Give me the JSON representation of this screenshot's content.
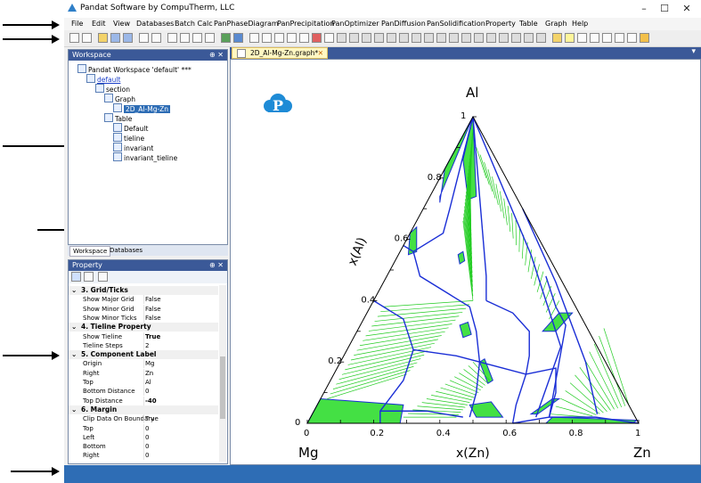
{
  "window": {
    "title": "Pandat Software by CompuTherm, LLC",
    "minimize": "–",
    "maximize": "☐",
    "close": "✕"
  },
  "menu": [
    "File",
    "Edit",
    "View",
    "Databases",
    "Batch Calc",
    "PanPhaseDiagram",
    "PanPrecipitation",
    "PanOptimizer",
    "PanDiffusion",
    "PanSolidification",
    "Property",
    "Table",
    "Graph",
    "Help"
  ],
  "workspace": {
    "header": "Workspace",
    "pin": "⊕ ✕",
    "tree": [
      {
        "label": "Pandat Workspace 'default' ***",
        "indent": 0,
        "link": false
      },
      {
        "label": "default",
        "indent": 1,
        "link": true
      },
      {
        "label": "section",
        "indent": 2,
        "link": false
      },
      {
        "label": "Graph",
        "indent": 3,
        "link": false
      },
      {
        "label": "2D_Al-Mg-Zn",
        "indent": 4,
        "link": false,
        "selected": true
      },
      {
        "label": "Table",
        "indent": 3,
        "link": false
      },
      {
        "label": "Default",
        "indent": 4,
        "link": false
      },
      {
        "label": "tieline",
        "indent": 4,
        "link": false
      },
      {
        "label": "invariant",
        "indent": 4,
        "link": false
      },
      {
        "label": "invariant_tieline",
        "indent": 4,
        "link": false
      }
    ],
    "tabs": [
      "Workspace",
      "Databases"
    ]
  },
  "property": {
    "header": "Property",
    "pin": "⊕ ✕",
    "rows": [
      {
        "cat": true,
        "name": "3. Grid/Ticks"
      },
      {
        "name": "Show Major Grid",
        "value": "False"
      },
      {
        "name": "Show Minor Grid",
        "value": "False"
      },
      {
        "name": "Show Minor Ticks",
        "value": "False"
      },
      {
        "cat": true,
        "name": "4. Tieline Property"
      },
      {
        "name": "Show Tieline",
        "value": "True",
        "bold": true
      },
      {
        "name": "Tieline Steps",
        "value": "2"
      },
      {
        "cat": true,
        "name": "5. Component Label"
      },
      {
        "name": "Origin",
        "value": "Mg"
      },
      {
        "name": "Right",
        "value": "Zn"
      },
      {
        "name": "Top",
        "value": "Al"
      },
      {
        "name": "Bottom Distance",
        "value": "0"
      },
      {
        "name": "Top Distance",
        "value": "-40",
        "bold": true
      },
      {
        "cat": true,
        "name": "6. Margin"
      },
      {
        "name": "Clip Data On Boundary",
        "value": "True"
      },
      {
        "name": "Top",
        "value": "0"
      },
      {
        "name": "Left",
        "value": "0"
      },
      {
        "name": "Bottom",
        "value": "0"
      },
      {
        "name": "Right",
        "value": "0"
      }
    ]
  },
  "document": {
    "tab_label": "2D_Al-Mg-Zn.graph*",
    "tab_close": "✕",
    "dropdown": "▾"
  },
  "chart_data": {
    "type": "ternary",
    "corners": {
      "top": "Al",
      "left": "Mg",
      "right": "Zn"
    },
    "xlabel": "x(Zn)",
    "ylabel": "x(Al)",
    "x_ticks": [
      "0",
      "0.2",
      "0.4",
      "0.6",
      "0.8",
      "1"
    ],
    "y_ticks": [
      "0",
      "0.2",
      "0.4",
      "0.6",
      "0.8",
      "1"
    ],
    "boundary_color": "#1a2ed6",
    "tieline_color": "#22cc22",
    "phase_fill_color": "#44e044"
  },
  "colors": {
    "panel_header": "#3b5998",
    "status_bar": "#2e6db5",
    "accent_logo": "#1e8bd6"
  }
}
